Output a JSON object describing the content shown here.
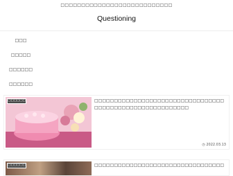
{
  "header": {
    "tagline": "□□□□□□□□□□□□□□□□□□□□□□□□□□□",
    "title": "Questioning"
  },
  "nav": {
    "items": [
      {
        "label": "□□□"
      },
      {
        "label": "□□□□□"
      },
      {
        "label": "□□□□□□"
      },
      {
        "label": "□□□□□□"
      }
    ]
  },
  "posts": [
    {
      "badge": "□□□□□□",
      "title": "□□□□□□□□□□□□□□□□□□□□□□□□□□□□□□□□□□□□□□□□□□□□□□□□□□□□□□□□□",
      "date": "2022.03.13",
      "icon": "clock-icon"
    },
    {
      "badge": "□□□□□□",
      "title": "□□□□□□□□□□□□□□□□□□□□□□□□□□□□□□□□□□□□□□□"
    }
  ]
}
